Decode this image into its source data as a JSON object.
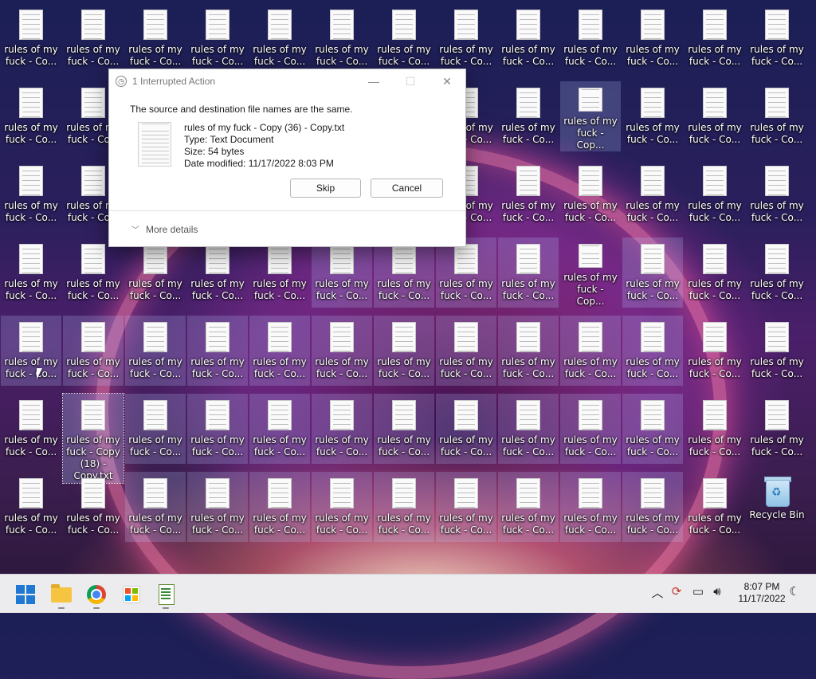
{
  "desktop": {
    "icon_label": "rules of my\nfuck - Co...",
    "icon_label_alt": "rules of my\nfuck - Cop...",
    "focused_label": "rules of my\nfuck - Copy\n(18) -\nCopy.txt",
    "overlap_label": "rules of my\nfuck - Co...",
    "recycle_label": "Recycle Bin"
  },
  "dialog": {
    "title": "1 Interrupted Action",
    "message": "The source and destination file names are the same.",
    "file_name": "rules of my fuck - Copy (36) - Copy.txt",
    "file_type": "Type: Text Document",
    "file_size": "Size: 54 bytes",
    "file_date": "Date modified: 11/17/2022 8:03 PM",
    "skip_label": "Skip",
    "cancel_label": "Cancel",
    "more_details_label": "More details"
  },
  "taskbar": {
    "time": "8:07 PM",
    "date": "11/17/2022",
    "apps": [
      "start-icon",
      "file-explorer-icon",
      "chrome-icon",
      "microsoft-store-icon",
      "notepad-icon"
    ],
    "tray": [
      "chevron-up-icon",
      "sync-error-icon",
      "network-icon",
      "volume-icon",
      "focus-assist-icon"
    ]
  }
}
